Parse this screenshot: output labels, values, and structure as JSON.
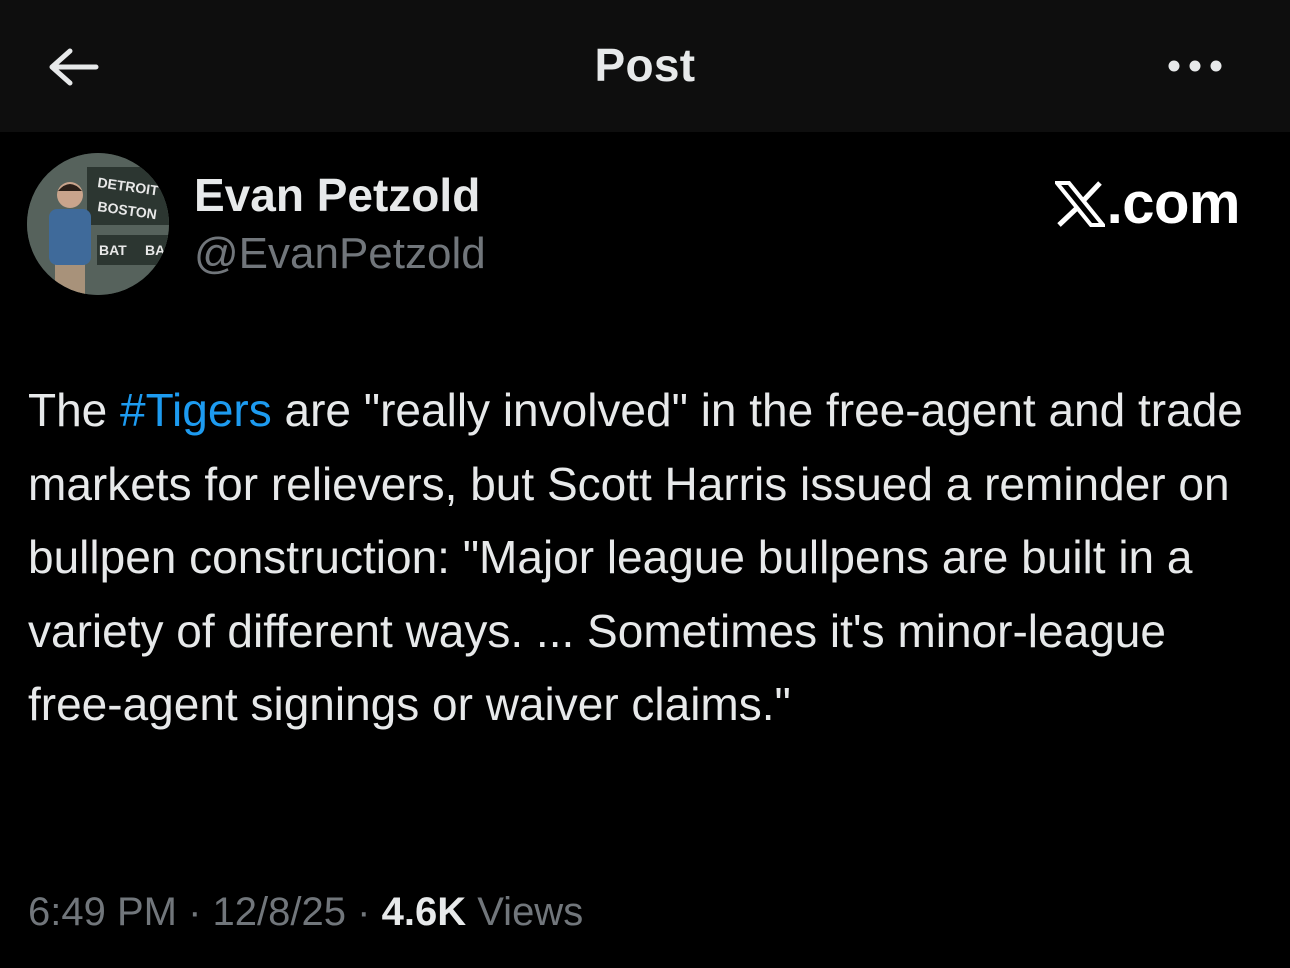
{
  "header": {
    "title": "Post",
    "back_icon": "arrow-left-icon",
    "more_icon": "more-horizontal-icon"
  },
  "author": {
    "name": "Evan Petzold",
    "handle": "@EvanPetzold",
    "avatar_text": {
      "line1": "DETROIT",
      "line2": "BOSTON",
      "line3": "BAT",
      "line4": "BA"
    }
  },
  "brand": {
    "logo_icon": "x-logo-icon",
    "suffix": ".com"
  },
  "post": {
    "text_before": "The ",
    "hashtag": "#Tigers",
    "text_after": " are \"really involved\" in the free-agent and trade markets for relievers, but Scott Harris issued a reminder on bullpen construction: \"Major league bullpens are built in a variety of different ways. ... Sometimes it's minor-league free-agent signings or waiver claims.\""
  },
  "meta": {
    "time": "6:49 PM",
    "separator": "·",
    "date": "12/8/25",
    "views_count": "4.6K",
    "views_label": "Views"
  },
  "colors": {
    "background": "#000000",
    "topbar": "#0e0e0e",
    "text": "#e7e9ea",
    "secondary": "#71767b",
    "accent": "#1d9bf0"
  }
}
